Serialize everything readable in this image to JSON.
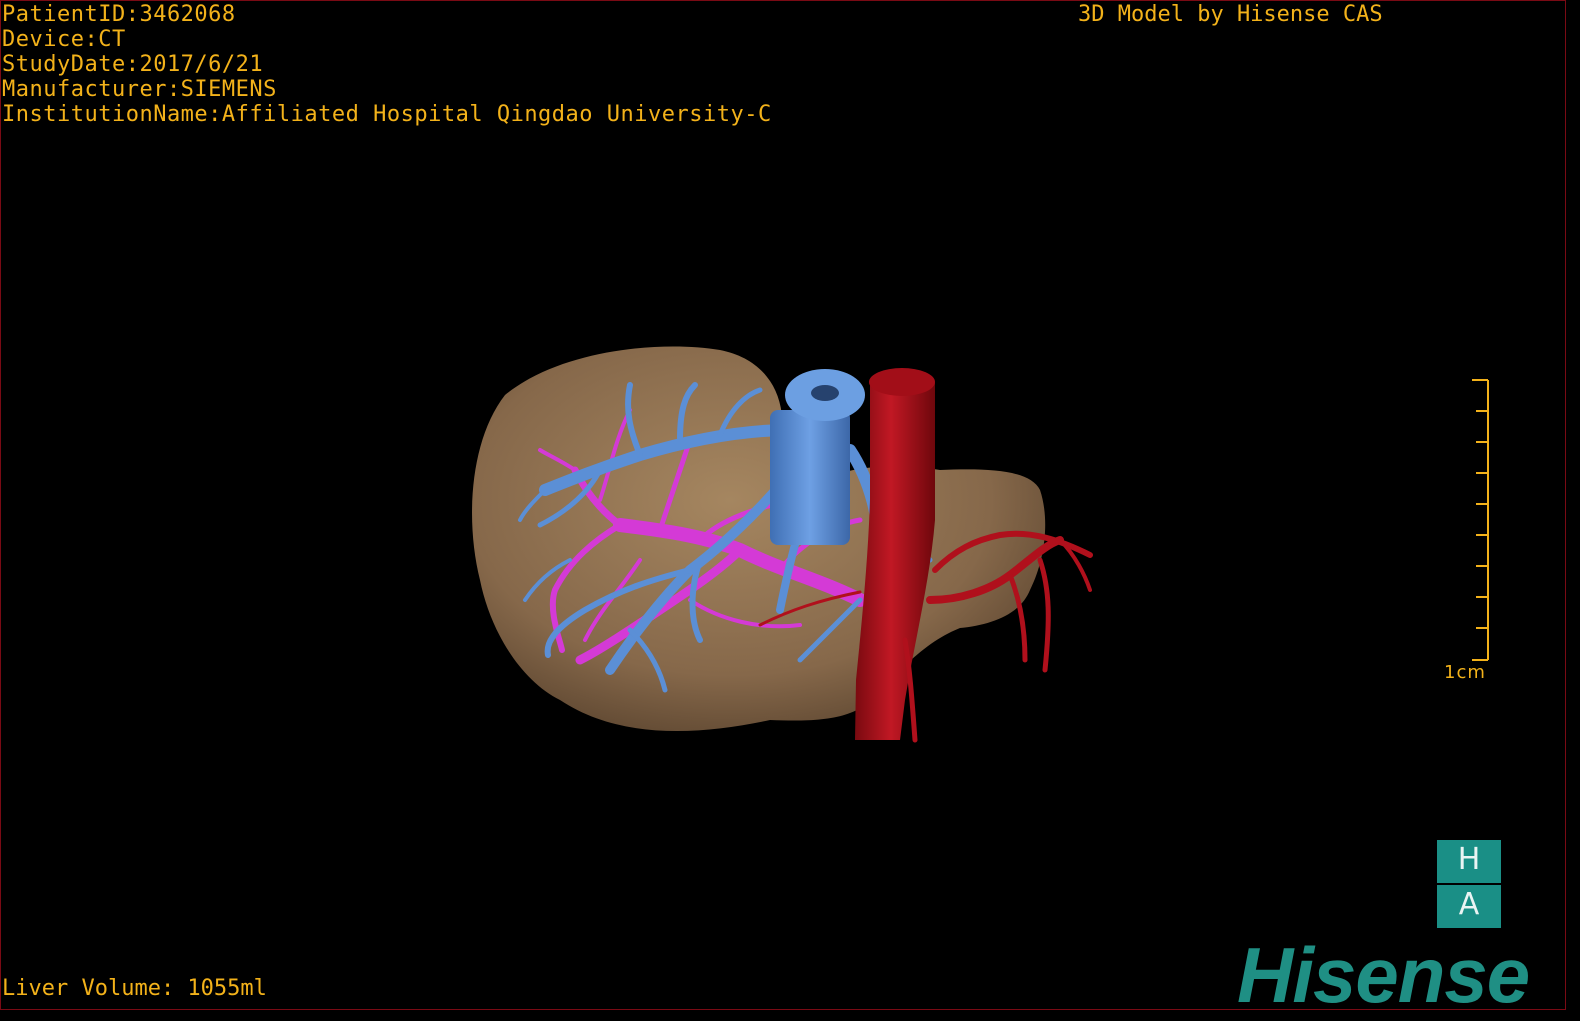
{
  "overlay": {
    "patient_id": "PatientID:3462068",
    "device": "Device:CT",
    "study_date": "StudyDate:2017/6/21",
    "manufacturer": "Manufacturer:SIEMENS",
    "institution": "InstitutionName:Affiliated Hospital Qingdao University-C",
    "credit": "3D Model by Hisense CAS",
    "liver_volume": "Liver Volume: 1055ml"
  },
  "scale_bar": {
    "label": "1cm"
  },
  "orientation": {
    "top": "H",
    "bottom": "A"
  },
  "brand": {
    "logo_text": "Hisense"
  },
  "colors": {
    "overlay_text": "#f3b21a",
    "liver": "#8a6a4a",
    "hepatic_vein": "#5b8fd6",
    "portal_vein": "#d43ad6",
    "artery": "#b0101c",
    "brand": "#1f8f84"
  }
}
